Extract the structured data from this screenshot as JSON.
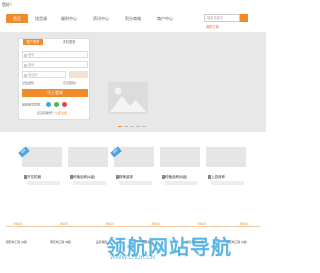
{
  "topbar": {
    "welcome": "您好！"
  },
  "nav": {
    "items": [
      {
        "label": "首页"
      },
      {
        "label": "找货源"
      },
      {
        "label": "福利中心"
      },
      {
        "label": "资讯中心"
      },
      {
        "label": "积分商城"
      },
      {
        "label": "商户中心"
      }
    ],
    "search_placeholder": "搜索关键字",
    "note": "我的订单"
  },
  "login": {
    "tabs": [
      "账户登录",
      "手机登录"
    ],
    "username_placeholder": "账号",
    "password_placeholder": "密码",
    "captcha_placeholder": "验证码",
    "remember_label": "记住密码",
    "forgot_label": "忘记密码？",
    "submit_label": "马上登录",
    "social_label": "其他账号登录：",
    "register_prefix": "还没有账号？",
    "register_link": "立即注册"
  },
  "cards": [
    {
      "ribbon": "推荐",
      "tag": "",
      "name": "开花机器"
    },
    {
      "ribbon": "",
      "tag": "",
      "name": "种植品种(A级)"
    },
    {
      "ribbon": "推荐",
      "tag": "",
      "name": "精美装饰"
    },
    {
      "ribbon": "",
      "tag": "",
      "name": "种植品种(B级)"
    },
    {
      "ribbon": "",
      "tag": "",
      "name": "上游良种"
    }
  ],
  "prices": [
    "¥8.00",
    "¥8.00",
    "¥8.00",
    "¥8.00",
    "¥8.00",
    "¥8.00"
  ],
  "bottom_list": [
    {
      "label": "钢结构工程 (A级)"
    },
    {
      "label": "钢结构工程 (B级)"
    },
    {
      "label": "品质保障"
    },
    {
      "label": "精选推荐"
    },
    {
      "label": "天然原料 (B级)"
    },
    {
      "label": "钢结构工程 (A级)"
    }
  ],
  "watermark": {
    "main": "领航网站导航",
    "sub": "WWW.LHDH.CN"
  },
  "colors": {
    "accent": "#f08a2b",
    "ribbon": "#4aa3df",
    "watermark": "#3fa8e0"
  }
}
